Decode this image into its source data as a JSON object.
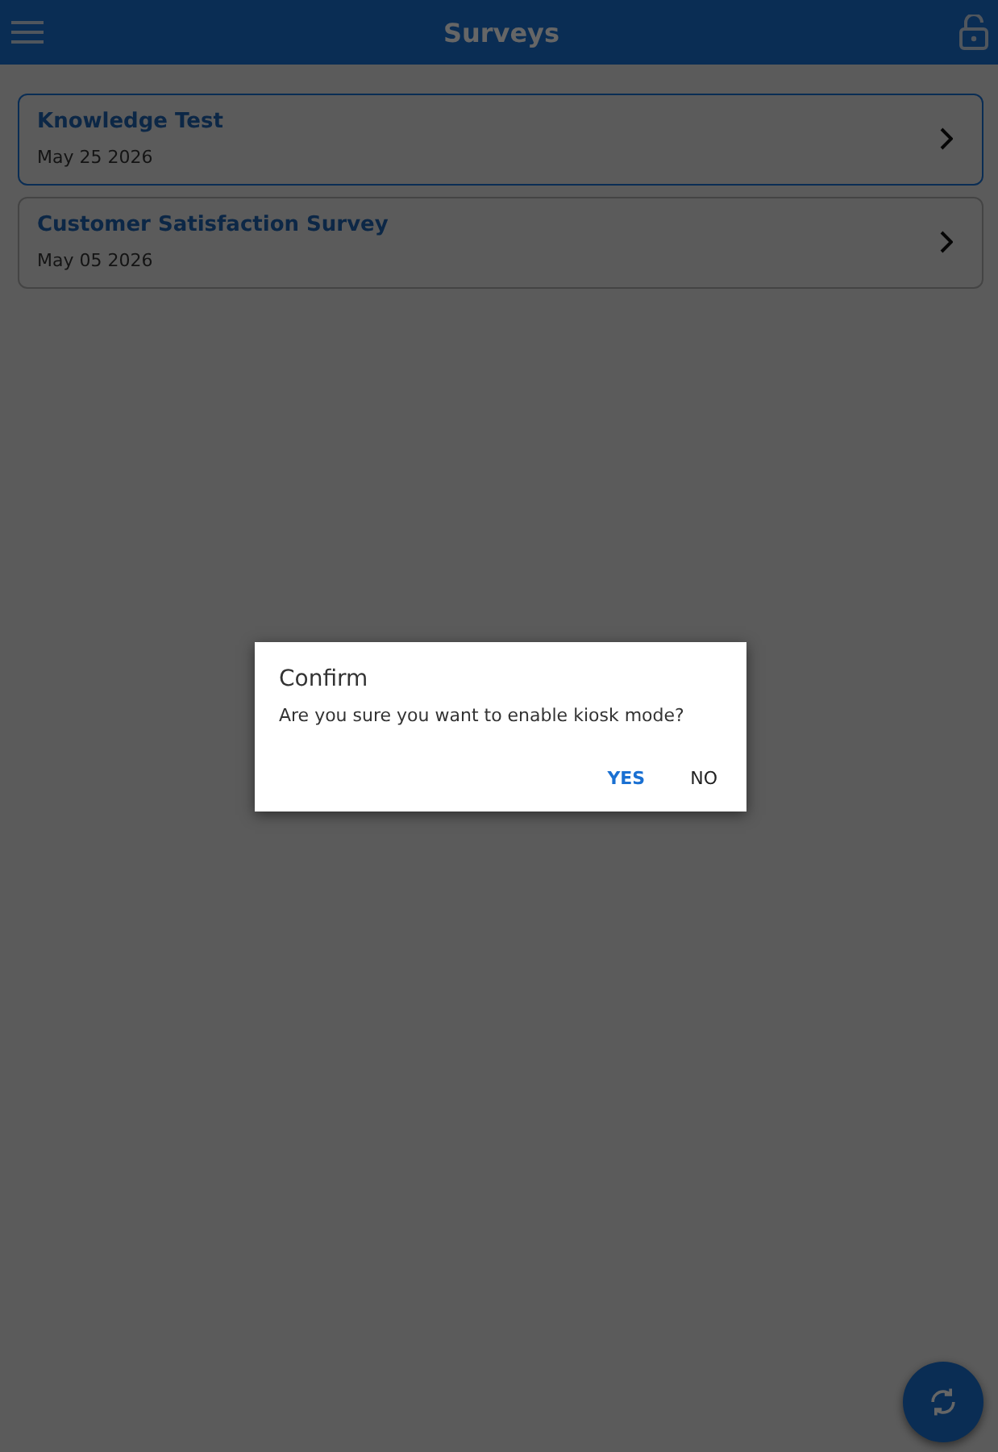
{
  "header": {
    "title": "Surveys"
  },
  "surveys": [
    {
      "title": "Knowledge Test",
      "date": "May 25 2026",
      "selected": true
    },
    {
      "title": "Customer Satisfaction Survey",
      "date": "May 05 2026",
      "selected": false
    }
  ],
  "dialog": {
    "title": "Confirm",
    "message": "Are you sure you want to enable kiosk mode?",
    "buttons": [
      {
        "label": "YES",
        "kind": "primary"
      },
      {
        "label": "NO",
        "kind": "plain"
      }
    ]
  }
}
